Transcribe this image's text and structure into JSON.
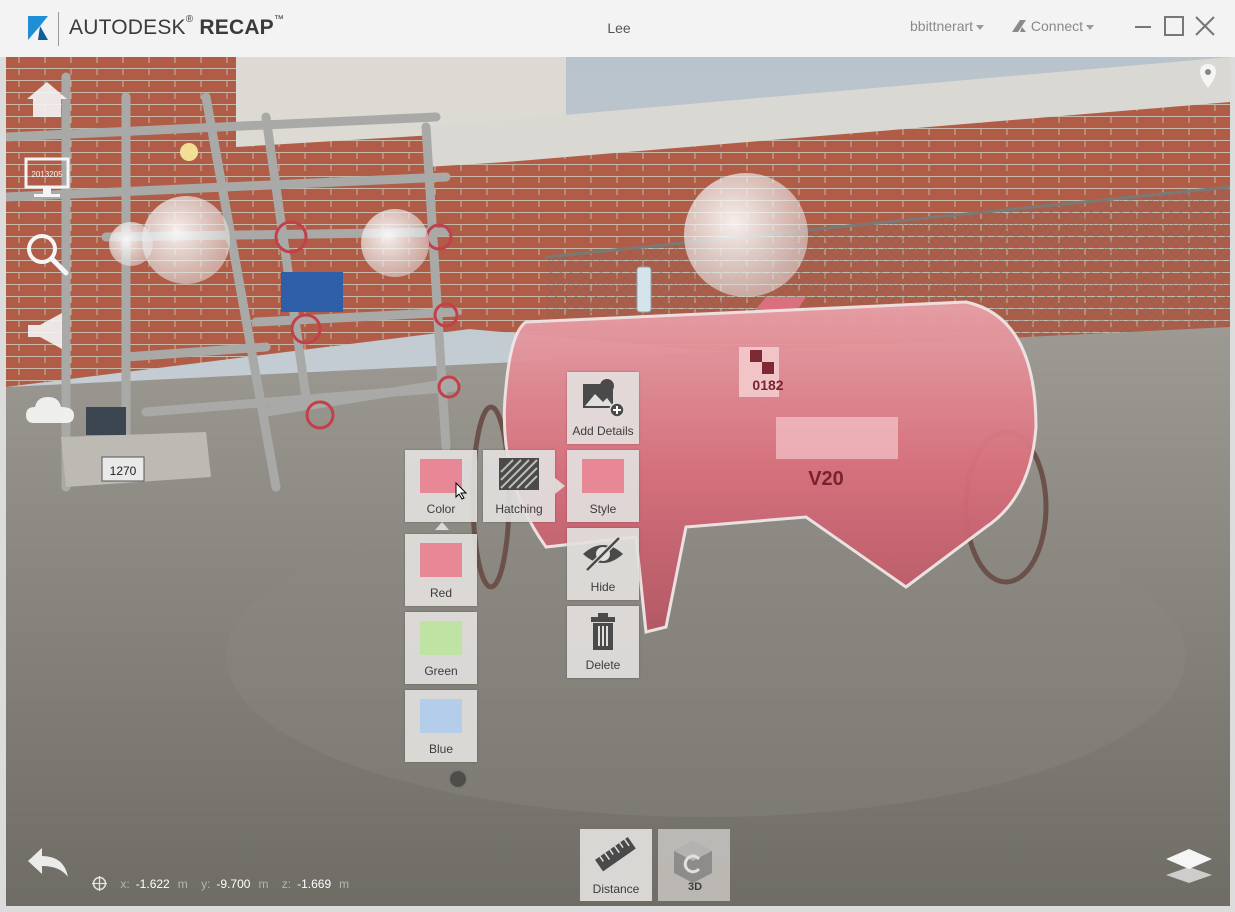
{
  "app": {
    "brand_prefix": "AUTODESK",
    "brand_reg": "®",
    "brand_product": "RECAP",
    "brand_tm": "™",
    "document_title": "Lee"
  },
  "header": {
    "user": "bbittnerart",
    "connect": "Connect"
  },
  "sidebar": {
    "items": [
      "home-icon",
      "monitor-icon",
      "search-icon",
      "announcement-icon",
      "cloud-icon"
    ]
  },
  "viewer": {
    "scan_label": "1270",
    "tank_number": "0182",
    "tank_text": "V20",
    "monitor_text": "2013205"
  },
  "context_menu": {
    "add_details": "Add Details",
    "color": "Color",
    "hatching": "Hatching",
    "style": "Style",
    "hide": "Hide",
    "delete": "Delete",
    "colors": [
      {
        "label": "Red",
        "hex": "#e88896"
      },
      {
        "label": "Green",
        "hex": "#bfe3a2"
      },
      {
        "label": "Blue",
        "hex": "#b3cdea"
      }
    ],
    "current_color": "#e88896"
  },
  "coords": {
    "x_label": "x:",
    "x": "-1.622",
    "x_unit": "m",
    "y_label": "y:",
    "y": "-9.700",
    "y_unit": "m",
    "z_label": "z:",
    "z": "-1.669",
    "z_unit": "m"
  },
  "toolbar": {
    "distance": "Distance",
    "view_3d": "3D"
  },
  "colors": {
    "accent_blue": "#1e8fd6",
    "highlight_red": "#e2707f",
    "tile_bg": "#e2e0dd"
  }
}
